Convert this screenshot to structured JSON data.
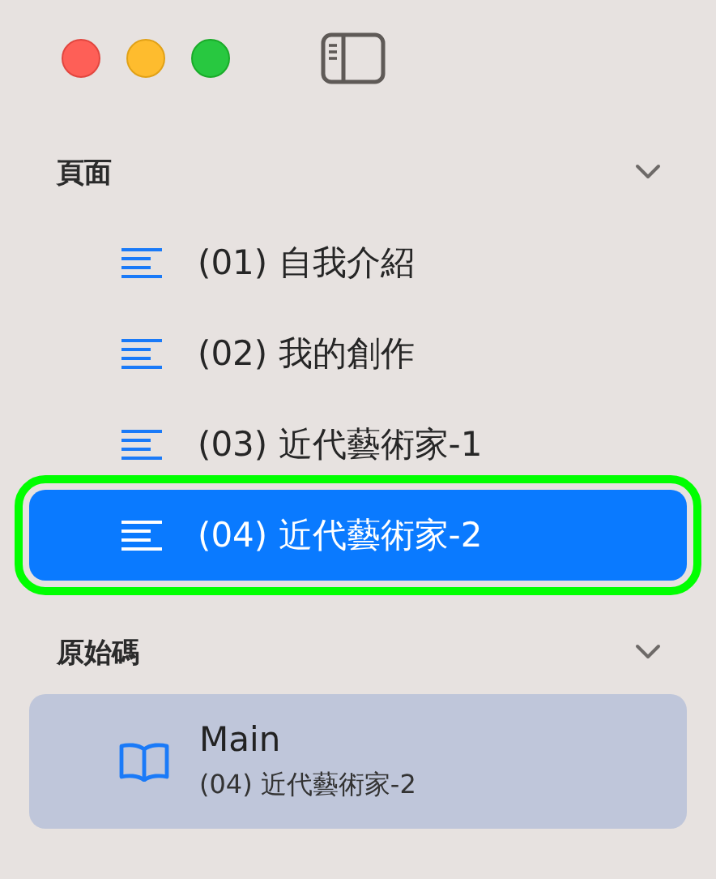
{
  "sections": [
    {
      "title": "頁面",
      "expanded": true,
      "items": [
        {
          "kind": "page",
          "label": "(01) 自我介紹",
          "selected": false
        },
        {
          "kind": "page",
          "label": "(02) 我的創作",
          "selected": false
        },
        {
          "kind": "page",
          "label": "(03) 近代藝術家-1",
          "selected": false
        },
        {
          "kind": "page",
          "label": "(04) 近代藝術家-2",
          "selected": true
        }
      ]
    },
    {
      "title": "原始碼",
      "expanded": true,
      "items": [
        {
          "kind": "source",
          "label": "Main",
          "subtitle": "(04) 近代藝術家-2",
          "selected": true
        }
      ]
    }
  ]
}
